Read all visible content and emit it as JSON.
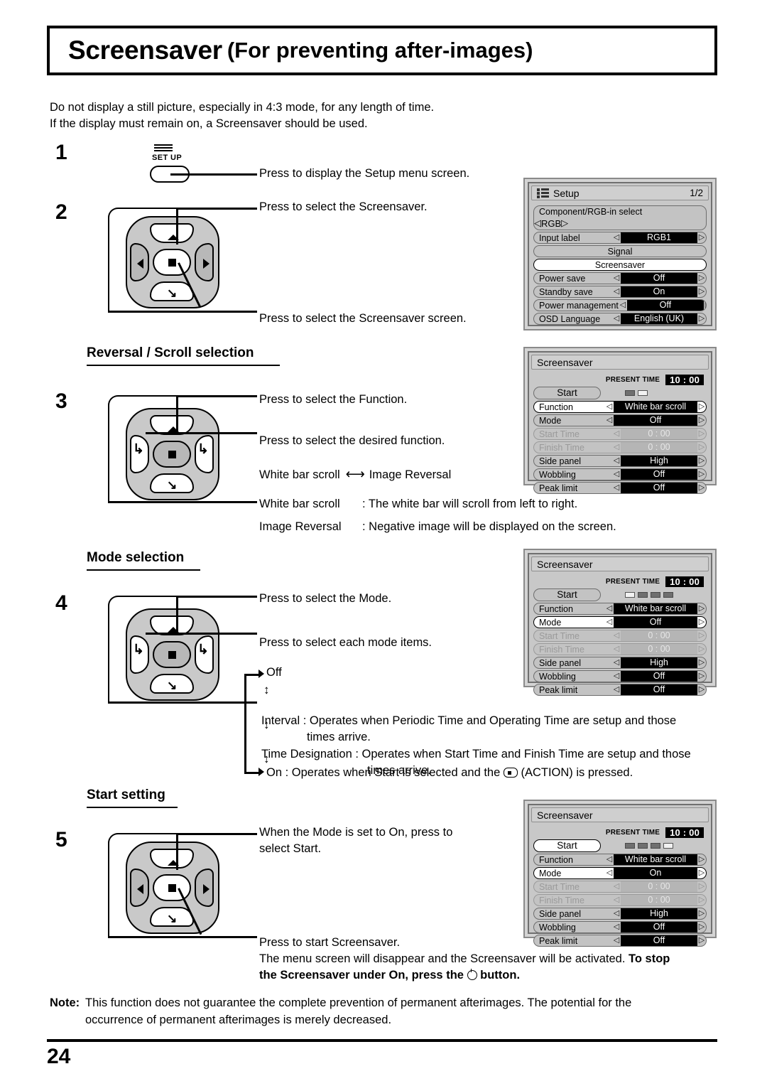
{
  "title": {
    "main": "Screensaver",
    "sub": "(For preventing after-images)"
  },
  "intro": {
    "line1": "Do not display a still picture, especially in 4:3 mode, for any length of time.",
    "line2": "If the display must remain on, a Screensaver should be used."
  },
  "steps": {
    "s1": "1",
    "s2": "2",
    "s3": "3",
    "s4": "4",
    "s5": "5"
  },
  "setup_button": {
    "label": "SET UP",
    "icon": "menu-lines-icon"
  },
  "callouts": {
    "c1": "Press to display the Setup menu screen.",
    "c2a": "Press to select the Screensaver.",
    "c2b": "Press to select the Screensaver screen.",
    "c3a": "Press to select the Function.",
    "c3b": "Press to select the desired function.",
    "c4a": "Press to select the Mode.",
    "c4b": "Press to select each mode items.",
    "c5a_l1": "When the Mode is set to On, press to",
    "c5a_l2": "select Start.",
    "c5b_l1": "Press to start Screensaver.",
    "c5b_l2": "The menu screen will disappear and the Screensaver will be activated. ",
    "c5b_bold1": "To stop",
    "c5b_bold2": "the Screensaver under On, press the",
    "c5b_bold3": "button."
  },
  "sections": {
    "reversal": "Reversal / Scroll selection",
    "mode": "Mode selection",
    "start": "Start setting"
  },
  "func_toggle": {
    "left": "White bar scroll",
    "right": "Image Reversal"
  },
  "func_desc": {
    "d1_label": "White bar scroll",
    "d1_text": ": The white bar will scroll from left to right.",
    "d2_label": "Image Reversal",
    "d2_text": ": Negative image will be displayed on the screen."
  },
  "mode_flow": {
    "off": "Off",
    "interval_l1": "Interval : Operates when Periodic Time and Operating Time are setup and those",
    "interval_l2": "times arrive.",
    "timedes_l1": "Time Designation : Operates when Start Time and Finish Time are setup and those",
    "timedes_l2": "times arrive.",
    "on_pre": "On : Operates when Start is selected and the",
    "on_post": "(ACTION) is pressed."
  },
  "note": {
    "label": "Note:",
    "line1": "This function does not guarantee the complete prevention of permanent afterimages. The potential for the",
    "line2": "occurrence of permanent afterimages is merely decreased."
  },
  "page_number": "24",
  "osd_setup": {
    "title": "Setup",
    "page": "1/2",
    "icon": "list-icon",
    "rows": [
      {
        "label": "Component/RGB-in  select",
        "value": "RGB",
        "type": "two-line"
      },
      {
        "label": "Input label",
        "value": "RGB1",
        "type": "value"
      },
      {
        "label": "Signal",
        "type": "pill"
      },
      {
        "label": "Screensaver",
        "type": "pill",
        "selected": true
      },
      {
        "label": "Power save",
        "value": "Off",
        "type": "value"
      },
      {
        "label": "Standby save",
        "value": "On",
        "type": "value"
      },
      {
        "label": "Power management",
        "value": "Off",
        "type": "value"
      },
      {
        "label": "OSD  Language",
        "value": "English (UK)",
        "type": "value"
      }
    ]
  },
  "osd_ss_a": {
    "title": "Screensaver",
    "present_time_label": "PRESENT TIME",
    "present_time": "10 : 00",
    "start_label": "Start",
    "dashes": [
      "dark",
      "lite"
    ],
    "rows": [
      {
        "label": "Function",
        "value": "White bar scroll",
        "selected": true
      },
      {
        "label": "Mode",
        "value": "Off"
      },
      {
        "label": "Start Time",
        "value": "0 : 00",
        "dim": true
      },
      {
        "label": "Finish Time",
        "value": "0 : 00",
        "dim": true
      },
      {
        "label": "Side  panel",
        "value": "High"
      },
      {
        "label": "Wobbling",
        "value": "Off"
      },
      {
        "label": "Peak limit",
        "value": "Off"
      }
    ]
  },
  "osd_ss_b": {
    "title": "Screensaver",
    "present_time_label": "PRESENT TIME",
    "present_time": "10 : 00",
    "start_label": "Start",
    "dashes": [
      "lite",
      "dark",
      "dark",
      "dark"
    ],
    "rows": [
      {
        "label": "Function",
        "value": "White bar scroll"
      },
      {
        "label": "Mode",
        "value": "Off",
        "selected": true
      },
      {
        "label": "Start Time",
        "value": "0 : 00",
        "dim": true
      },
      {
        "label": "Finish Time",
        "value": "0 : 00",
        "dim": true
      },
      {
        "label": "Side  panel",
        "value": "High"
      },
      {
        "label": "Wobbling",
        "value": "Off"
      },
      {
        "label": "Peak limit",
        "value": "Off"
      }
    ]
  },
  "osd_ss_c": {
    "title": "Screensaver",
    "present_time_label": "PRESENT TIME",
    "present_time": "10 : 00",
    "start_label": "Start",
    "start_selected": true,
    "dashes": [
      "dark",
      "dark",
      "dark",
      "lite"
    ],
    "rows": [
      {
        "label": "Function",
        "value": "White bar scroll"
      },
      {
        "label": "Mode",
        "value": "On",
        "selected": true
      },
      {
        "label": "Start Time",
        "value": "0 : 00",
        "dim": true
      },
      {
        "label": "Finish Time",
        "value": "0 : 00",
        "dim": true
      },
      {
        "label": "Side  panel",
        "value": "High"
      },
      {
        "label": "Wobbling",
        "value": "Off"
      },
      {
        "label": "Peak limit",
        "value": "Off"
      }
    ]
  }
}
